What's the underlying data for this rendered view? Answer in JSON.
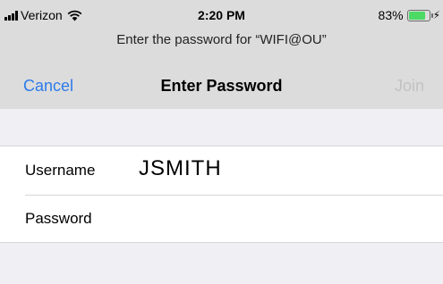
{
  "status_bar": {
    "carrier": "Verizon",
    "time": "2:20 PM",
    "battery_percent": "83%",
    "battery_level": 0.83,
    "battery_color": "#4cd964",
    "icons": [
      "signal-icon",
      "wifi-icon",
      "battery-icon",
      "charging-icon"
    ]
  },
  "prompt": "Enter the password for “WIFI@OU”",
  "navbar": {
    "cancel_label": "Cancel",
    "title": "Enter Password",
    "join_label": "Join",
    "accent_color": "#2d7bea",
    "disabled_color": "#c2c2c2"
  },
  "form": {
    "username": {
      "label": "Username",
      "value": "JSMITH"
    },
    "password": {
      "label": "Password",
      "value": ""
    }
  }
}
